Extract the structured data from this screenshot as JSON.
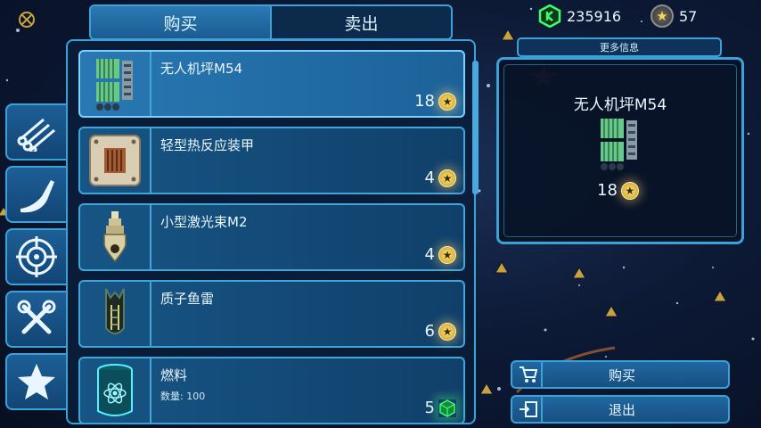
{
  "tabs": {
    "buy": "购买",
    "sell": "卖出",
    "active": "buy"
  },
  "currency": {
    "credits": "235916",
    "stars": "57"
  },
  "categories": [
    {
      "icon": "pipes-icon"
    },
    {
      "icon": "crane-arm-icon"
    },
    {
      "icon": "target-icon"
    },
    {
      "icon": "wrench-tools-icon"
    },
    {
      "icon": "star-icon"
    }
  ],
  "items": [
    {
      "name": "无人机坪M54",
      "price": "18",
      "currency": "star",
      "icon": "drone-bay-icon",
      "selected": true
    },
    {
      "name": "轻型热反应装甲",
      "price": "4",
      "currency": "star",
      "icon": "armor-plate-icon"
    },
    {
      "name": "小型激光束M2",
      "price": "4",
      "currency": "star",
      "icon": "laser-beam-icon"
    },
    {
      "name": "质子鱼雷",
      "price": "6",
      "currency": "star",
      "icon": "torpedo-icon"
    },
    {
      "name": "燃料",
      "qty": "数量: 100",
      "price": "5",
      "currency": "credit",
      "icon": "fuel-barrel-icon"
    }
  ],
  "info": {
    "header": "更多信息",
    "name": "无人机坪M54",
    "price": "18"
  },
  "actions": {
    "buy": "购买",
    "exit": "退出"
  },
  "colors": {
    "accent": "#3aa2d8",
    "gold": "#ffd84a",
    "credit_green": "#3dff6a"
  }
}
